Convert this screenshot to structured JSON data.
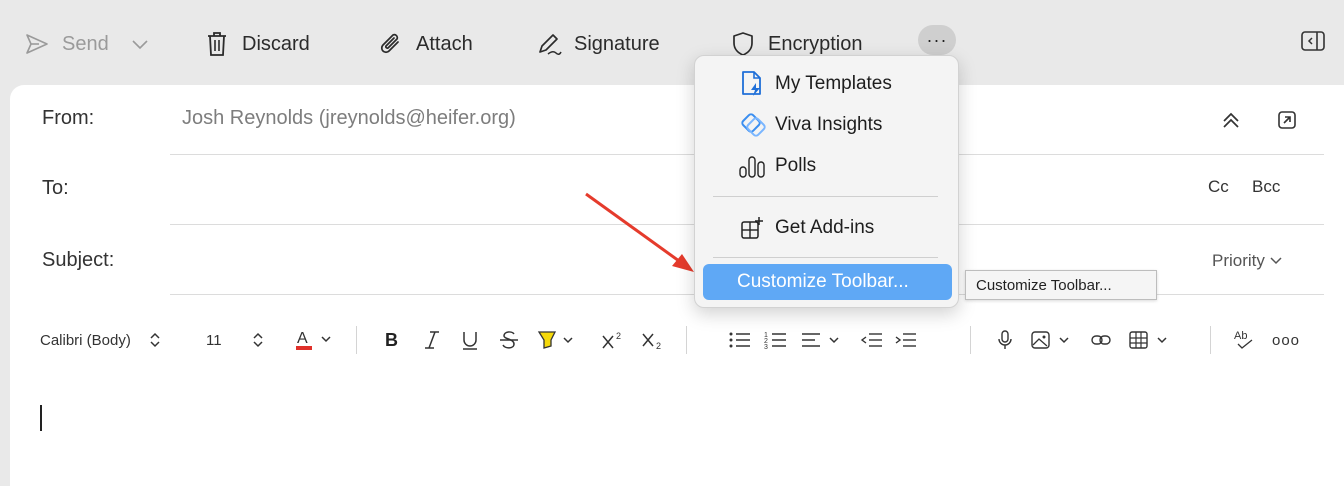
{
  "toolbar": {
    "send_label": "Send",
    "discard_label": "Discard",
    "attach_label": "Attach",
    "signature_label": "Signature",
    "encryption_label": "Encryption",
    "more_label": "···"
  },
  "header": {
    "from_label": "From:",
    "from_value": "Josh Reynolds (jreynolds@heifer.org)",
    "to_label": "To:",
    "cc_label": "Cc",
    "bcc_label": "Bcc",
    "subject_label": "Subject:",
    "priority_label": "Priority"
  },
  "format_bar": {
    "font_name": "Calibri (Body)",
    "font_size": "11",
    "more_label": "ooo"
  },
  "menu": {
    "items": [
      {
        "label": "My Templates",
        "icon": "templates-icon"
      },
      {
        "label": "Viva Insights",
        "icon": "viva-insights-icon"
      },
      {
        "label": "Polls",
        "icon": "polls-icon"
      },
      {
        "label": "Get Add-ins",
        "icon": "add-ins-icon"
      },
      {
        "label": "Customize Toolbar...",
        "icon": ""
      }
    ]
  },
  "tooltip": {
    "text": "Customize Toolbar..."
  },
  "colors": {
    "highlight": "#5fa8f5",
    "arrow": "#e53b2c",
    "font_color_swatch": "#e0302a",
    "highlighter_swatch": "#f5d90a",
    "viva_blue": "#3a8ef0",
    "templates_blue": "#1f6fd8"
  }
}
